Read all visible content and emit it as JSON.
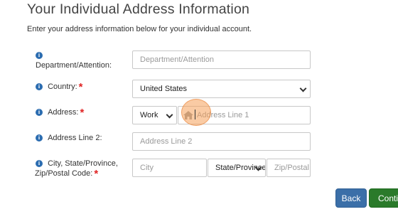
{
  "header": {
    "title": "Your Individual Address Information",
    "subtitle": "Enter your address information below for your individual account."
  },
  "form": {
    "department": {
      "label": "Department/Attention:",
      "placeholder": "Department/Attention"
    },
    "country": {
      "label": "Country:",
      "required_mark": "*",
      "value": "United States"
    },
    "address": {
      "label": "Address:",
      "required_mark": "*",
      "type_value": "Work",
      "placeholder": "Address Line 1"
    },
    "address2": {
      "label": "Address Line 2:",
      "placeholder": "Address Line 2"
    },
    "city_state_zip": {
      "label_line1": "City, State/Province,",
      "label_line2": "Zip/Postal Code:",
      "required_mark": "*",
      "city_placeholder": "City",
      "state_placeholder": "State/Province",
      "zip_placeholder": "Zip/Postal Code"
    }
  },
  "buttons": {
    "back": "Back",
    "continue": "Continue"
  },
  "icons": {
    "info": "info-icon",
    "home": "home-icon",
    "chevron": "chevron-down-icon"
  },
  "colors": {
    "info_icon": "#2b6cb0",
    "required": "#e02424",
    "back_button": "#3b6fa8",
    "continue_button": "#2a7a2a",
    "cursor_highlight": "#f5a05a"
  }
}
